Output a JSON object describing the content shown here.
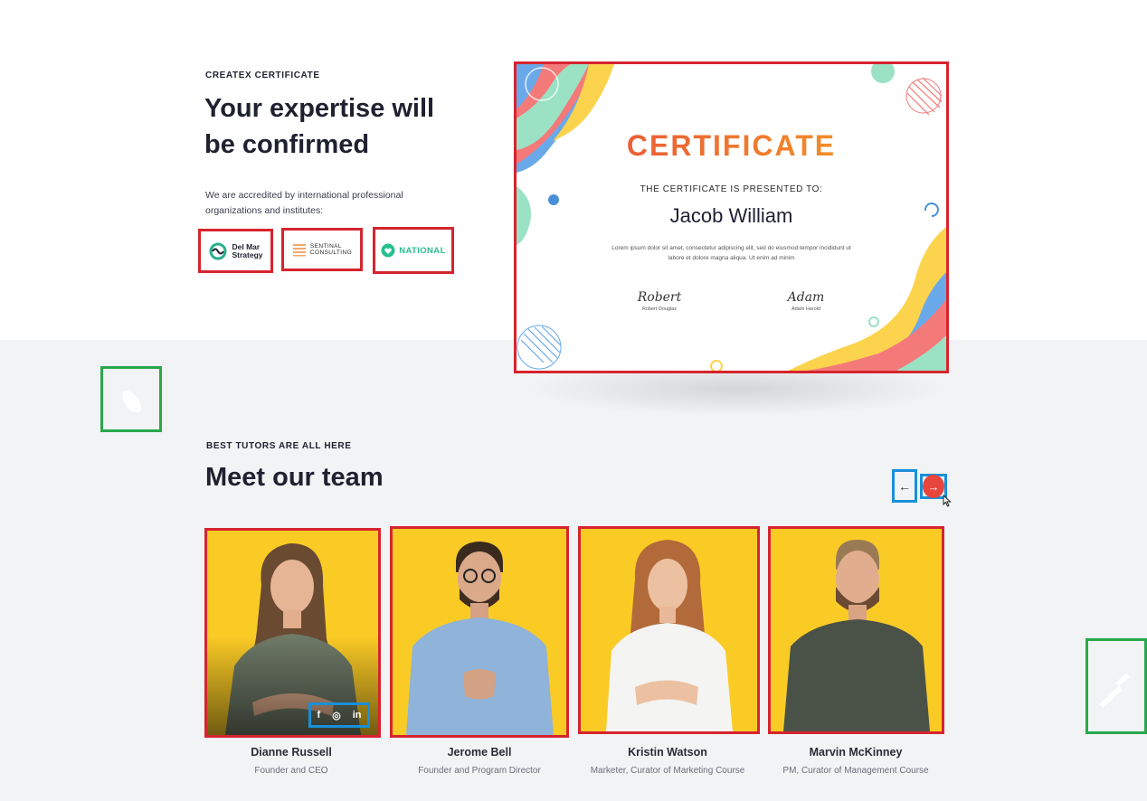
{
  "certificate_section": {
    "eyebrow": "CREATEX CERTIFICATE",
    "title_line1": "Your expertise will",
    "title_line2": "be confirmed",
    "description_line1": "We are accredited by international professional",
    "description_line2": "organizations and institutes:",
    "partners": [
      {
        "name_line1": "Del Mar",
        "name_line2": "Strategy",
        "icon": "delmar-logo-icon"
      },
      {
        "name_line1": "SENTINAL",
        "name_line2": "CONSULTING",
        "icon": "sentinal-logo-icon"
      },
      {
        "name_line1": "NATIONAL",
        "icon": "national-logo-icon"
      }
    ],
    "certificate": {
      "heading": "CERTIFICATE",
      "presented_to": "THE CERTIFICATE IS PRESENTED TO:",
      "recipient": "Jacob William",
      "body_line1": "Lorem ipsum dolor sit amet, consectetur adipiscing elit, sed do eiusmod tempor incididunt ut",
      "body_line2": "labore et dolore magna aliqua. Ut enim ad minim",
      "signatures": [
        {
          "script": "Robert",
          "caption": "Robert Douglas"
        },
        {
          "script": "Adam",
          "caption": "Adam Harold"
        }
      ]
    }
  },
  "team_section": {
    "eyebrow": "BEST TUTORS ARE ALL HERE",
    "title": "Meet our team",
    "prev_icon": "arrow-left-icon",
    "next_icon": "arrow-right-icon",
    "prev_glyph": "←",
    "next_glyph": "→",
    "members": [
      {
        "name": "Dianne Russell",
        "role": "Founder and CEO"
      },
      {
        "name": "Jerome Bell",
        "role": "Founder and Program Director"
      },
      {
        "name": "Kristin Watson",
        "role": "Marketer, Curator of Marketing Course"
      },
      {
        "name": "Marvin McKinney",
        "role": "PM, Curator of Management Course"
      }
    ],
    "social": {
      "facebook": "f",
      "instagram": "◎",
      "linkedin": "in"
    }
  },
  "colors": {
    "accent": "#e8453c",
    "card_bg": "#fbcb25",
    "annotation_red": "#d6242e",
    "annotation_blue": "#1a8fd8",
    "annotation_green": "#29a84a"
  }
}
